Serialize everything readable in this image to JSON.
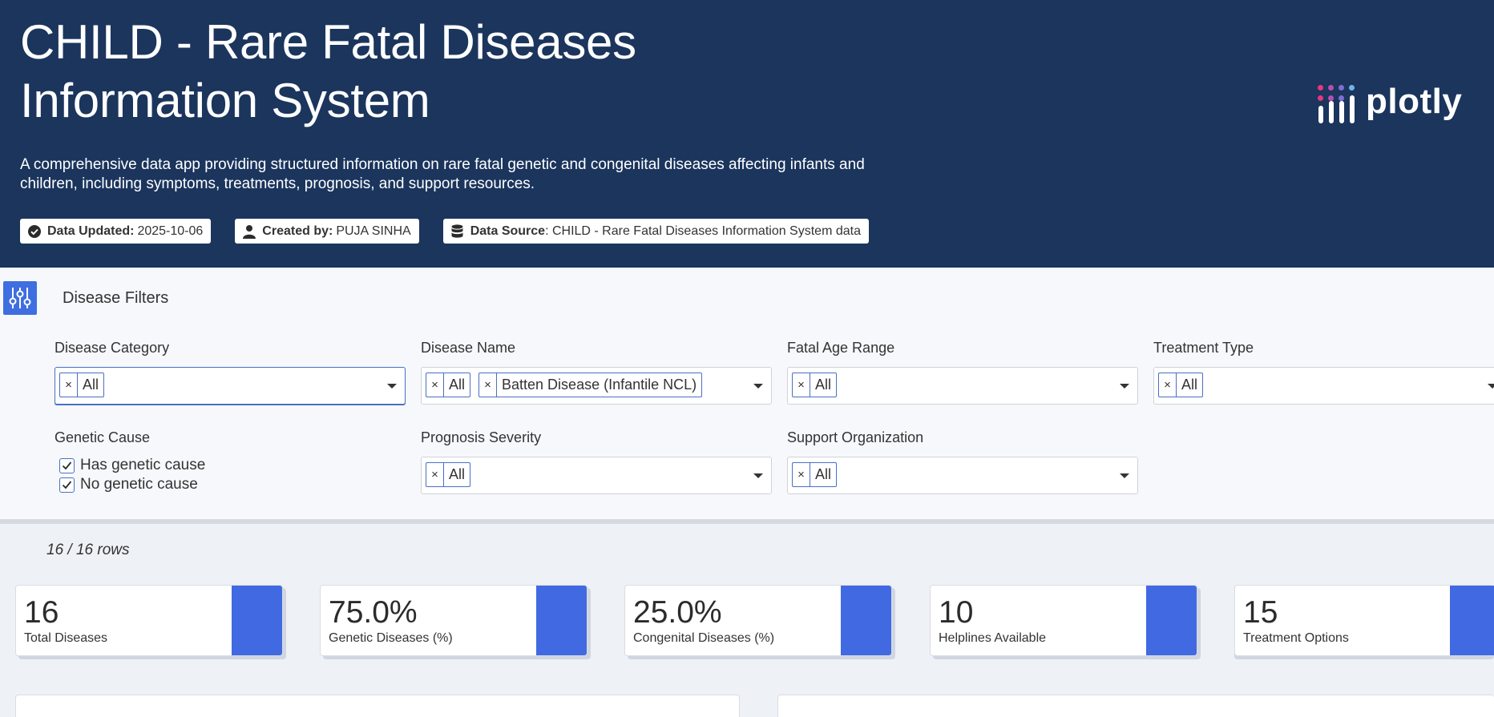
{
  "header": {
    "title": "CHILD - Rare Fatal Diseases Information System",
    "subtitle": "A comprehensive data app providing structured information on rare fatal genetic and congenital diseases affecting infants and children, including symptoms, treatments, prognosis, and support resources.",
    "badges": [
      {
        "icon": "check-circle-icon",
        "label": "Data Updated:",
        "value": "2025-10-06"
      },
      {
        "icon": "user-icon",
        "label": "Created by:",
        "value": "PUJA SINHA"
      },
      {
        "icon": "database-icon",
        "label": "Data Source",
        "value": ": CHILD - Rare Fatal Diseases Information System data"
      }
    ],
    "logo_text": "plotly"
  },
  "filters": {
    "title": "Disease Filters",
    "disease_category": {
      "label": "Disease Category",
      "chips": [
        "All"
      ]
    },
    "disease_name": {
      "label": "Disease Name",
      "chips": [
        "All",
        "Batten Disease (Infantile NCL)"
      ]
    },
    "fatal_age_range": {
      "label": "Fatal Age Range",
      "chips": [
        "All"
      ]
    },
    "treatment_type": {
      "label": "Treatment Type",
      "chips": [
        "All"
      ]
    },
    "genetic_cause": {
      "label": "Genetic Cause",
      "options": [
        {
          "label": "Has genetic cause",
          "checked": true
        },
        {
          "label": "No genetic cause",
          "checked": true
        }
      ]
    },
    "prognosis_severity": {
      "label": "Prognosis Severity",
      "chips": [
        "All"
      ]
    },
    "support_organization": {
      "label": "Support Organization",
      "chips": [
        "All"
      ]
    },
    "chip_remove_glyph": "×"
  },
  "summary": {
    "rows_count": "16 / 16 rows",
    "cards": [
      {
        "value": "16",
        "label": "Total Diseases"
      },
      {
        "value": "75.0%",
        "label": "Genetic Diseases (%)"
      },
      {
        "value": "25.0%",
        "label": "Congenital Diseases (%)"
      },
      {
        "value": "10",
        "label": "Helplines Available"
      },
      {
        "value": "15",
        "label": "Treatment Options"
      }
    ]
  },
  "colors": {
    "header_bg": "#1b355d",
    "accent": "#4169e1",
    "logo_dots": [
      "#e8377d",
      "#b84fb0",
      "#7c6fd6",
      "#6fb6e8"
    ]
  }
}
